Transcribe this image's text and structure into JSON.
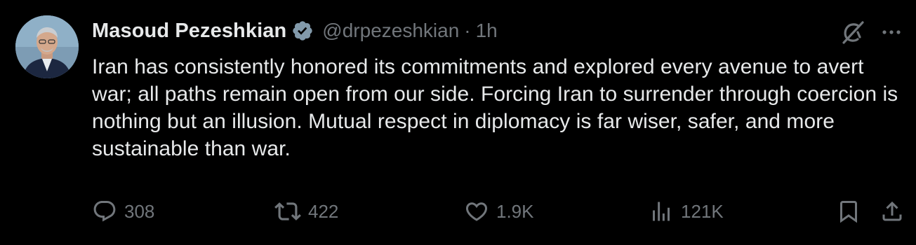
{
  "author": {
    "name": "Masoud Pezeshkian",
    "handle": "@drpezeshkian",
    "separator": "·",
    "time": "1h",
    "verified_color": "#829aab"
  },
  "tweet": {
    "text": "Iran has consistently honored its commitments and explored every avenue to avert war; all paths remain open from our side. Forcing Iran to surrender through coercion is nothing but an illusion. Mutual respect in diplomacy is far wiser, safer, and more sustainable than war."
  },
  "actions": {
    "replies": "308",
    "reposts": "422",
    "likes": "1.9K",
    "views": "121K"
  },
  "icons": {
    "header": [
      "grok-icon",
      "more-icon"
    ],
    "actions": [
      "reply-icon",
      "repost-icon",
      "like-icon",
      "views-icon",
      "bookmark-icon",
      "share-icon"
    ]
  },
  "colors": {
    "background": "#000000",
    "text": "#e7e9ea",
    "muted": "#71767b"
  }
}
